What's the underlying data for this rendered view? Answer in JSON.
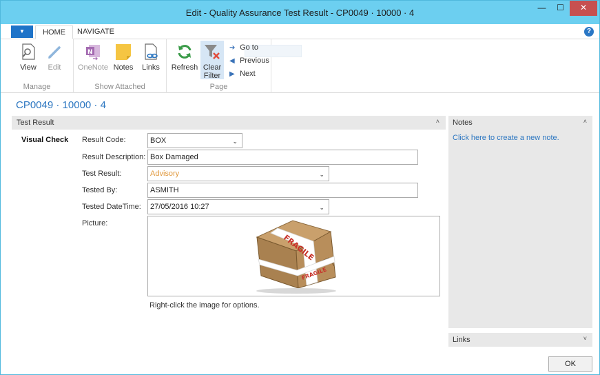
{
  "window": {
    "title": "Edit - Quality Assurance Test Result - CP0049 · 10000 · 4",
    "minimize": "—",
    "maximize": "☐",
    "close": "✕"
  },
  "ribbon": {
    "app_menu": "▼",
    "tabs": [
      {
        "label": "HOME"
      },
      {
        "label": "NAVIGATE"
      }
    ],
    "help": "?",
    "groups": {
      "manage": {
        "label": "Manage",
        "view": "View",
        "edit": "Edit"
      },
      "show_attached": {
        "label": "Show Attached",
        "onenote": "OneNote",
        "notes": "Notes",
        "links": "Links"
      },
      "page": {
        "label": "Page",
        "refresh": "Refresh",
        "clear_filter_1": "Clear",
        "clear_filter_2": "Filter",
        "goto": "Go to",
        "previous": "Previous",
        "next": "Next"
      }
    },
    "icons": {
      "view": "magnifier-document-icon",
      "edit": "pencil-icon",
      "onenote": "onenote-icon",
      "notes": "sticky-note-icon",
      "links": "link-document-icon",
      "refresh": "refresh-icon",
      "clear_filter": "clear-filter-icon",
      "goto": "arrow-right-icon",
      "previous": "triangle-left-icon",
      "next": "triangle-right-icon"
    }
  },
  "record": {
    "title": "CP0049 · 10000 · 4"
  },
  "fasttab": {
    "title": "Test Result",
    "chevron": "˄",
    "group_caption": "Visual Check",
    "fields": {
      "result_code": {
        "label": "Result Code:",
        "value": "BOX"
      },
      "result_description": {
        "label": "Result Description:",
        "value": "Box Damaged"
      },
      "test_result": {
        "label": "Test Result:",
        "value": "Advisory"
      },
      "tested_by": {
        "label": "Tested By:",
        "value": "ASMITH"
      },
      "tested_datetime": {
        "label": "Tested DateTime:",
        "value": "27/05/2016 10:27"
      },
      "picture": {
        "label": "Picture:",
        "hint": "Right-click the image for options."
      }
    },
    "picture_image": {
      "name": "damaged-fragile-box-image",
      "stamp_text_1": "FRAGILE",
      "stamp_text_2": "FRAGILE"
    }
  },
  "factbox": {
    "notes": {
      "title": "Notes",
      "chevron": "˄",
      "link": "Click here to create a new note."
    },
    "links": {
      "title": "Links",
      "chevron": "˅"
    }
  },
  "footer": {
    "ok": "OK"
  },
  "colors": {
    "titlebar": "#6ccff0",
    "link": "#2d77c1",
    "advisory": "#e0973a",
    "close": "#c75050"
  }
}
